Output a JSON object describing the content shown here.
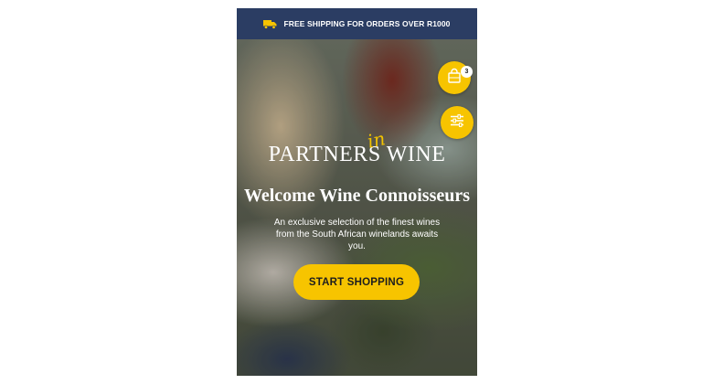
{
  "banner": {
    "text": "FREE SHIPPING FOR ORDERS OVER R1000",
    "icon": "truck-icon"
  },
  "cart": {
    "count": "3",
    "icon": "shopping-bag-icon"
  },
  "filter": {
    "icon": "sliders-icon"
  },
  "logo": {
    "main": "PARTNERS WINE",
    "in": "in"
  },
  "hero": {
    "title": "Welcome Wine Connoisseurs",
    "subtitle": "An exclusive selection of the finest wines from the South African winelands awaits you.",
    "cta": "START SHOPPING"
  },
  "colors": {
    "accent": "#f7c400",
    "banner_bg": "#2b3d63",
    "text_light": "#ffffff"
  }
}
